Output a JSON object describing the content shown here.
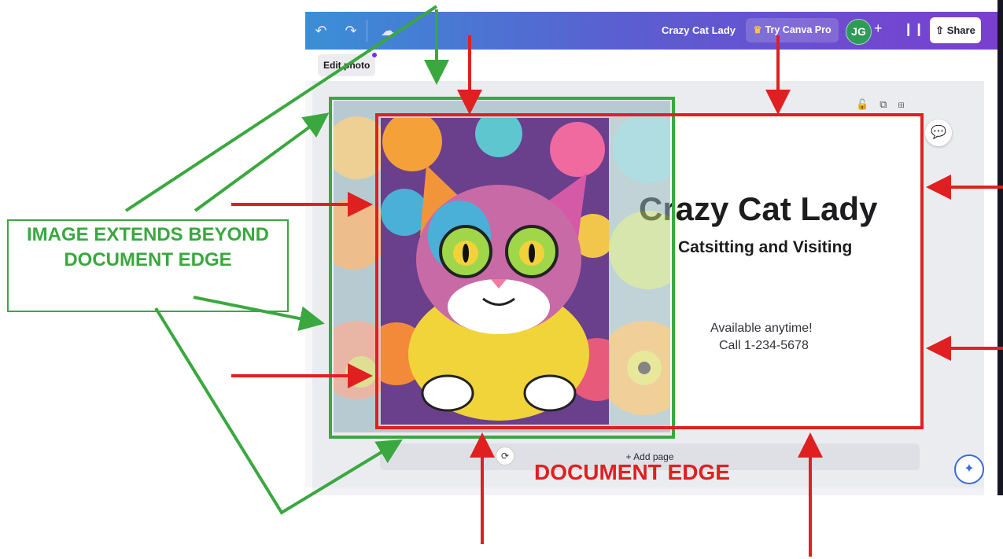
{
  "topbar": {
    "undo_icon": "undo-icon",
    "redo_icon": "redo-icon",
    "save_icon": "cloud-check-icon",
    "doc_title": "Crazy Cat Lady",
    "pro_label": "Try Canva Pro",
    "avatar_initials": "JG",
    "plus_label": "+",
    "share_label": "Share"
  },
  "toolbar": {
    "edit_photo_label": "Edit photo"
  },
  "design": {
    "headline": "Crazy Cat Lady",
    "subheadline": "Catsitting and Visiting",
    "availability": "Available anytime!",
    "phone": "Call 1-234-5678"
  },
  "canvas": {
    "add_page_label": "+ Add page"
  },
  "annotations": {
    "green_callout": "IMAGE EXTENDS BEYOND DOCUMENT EDGE",
    "red_label": "DOCUMENT EDGE"
  },
  "colors": {
    "annotation_green": "#3aa83f",
    "annotation_red": "#e02020",
    "canva_gradient_start": "#3a8fd6",
    "canva_gradient_end": "#7a3fcf"
  }
}
